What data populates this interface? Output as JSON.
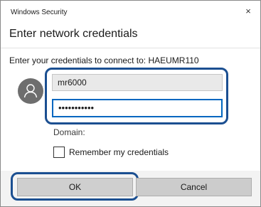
{
  "window": {
    "title": "Windows Security",
    "close_glyph": "×"
  },
  "dialog": {
    "heading": "Enter network credentials",
    "prompt": "Enter your credentials to connect to: HAEUMR110"
  },
  "form": {
    "username_value": "mr6000",
    "password_value": "•••••••••••",
    "domain_label": "Domain:",
    "remember_label": "Remember my credentials",
    "remember_checked": false
  },
  "buttons": {
    "ok_label": "OK",
    "cancel_label": "Cancel"
  },
  "icons": {
    "avatar": "user-avatar-icon",
    "close": "close-icon"
  },
  "colors": {
    "highlight_ring": "#1b4f91",
    "focus_border": "#0067c0",
    "avatar_bg": "#6e6e6e",
    "button_bar_bg": "#f3f3f3"
  }
}
